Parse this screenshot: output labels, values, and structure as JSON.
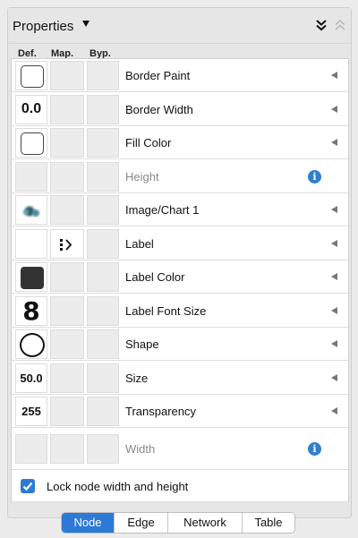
{
  "panel": {
    "title": "Properties",
    "header_icons": [
      "chevron-down-double-icon",
      "chevron-up-double-icon"
    ]
  },
  "columns": {
    "def": "Def.",
    "map": "Map.",
    "byp": "Byp."
  },
  "rows": [
    {
      "label": "Border Paint",
      "default": "",
      "default_icon": "outline-square-swatch",
      "enabled": true,
      "trailing": "arrow"
    },
    {
      "label": "Border Width",
      "default": "0.0",
      "enabled": true,
      "trailing": "arrow"
    },
    {
      "label": "Fill Color",
      "default": "",
      "default_icon": "outline-square-swatch",
      "enabled": true,
      "trailing": "arrow"
    },
    {
      "label": "Height",
      "default": "",
      "enabled": false,
      "trailing": "info"
    },
    {
      "label": "Image/Chart 1",
      "default": "",
      "default_icon": "blurred-dots-image",
      "enabled": true,
      "trailing": "arrow"
    },
    {
      "label": "Label",
      "default": "",
      "mapping_icon": "passthrough-mapping-icon",
      "enabled": true,
      "trailing": "arrow"
    },
    {
      "label": "Label Color",
      "default": "",
      "default_icon": "dark-square-swatch",
      "default_color": "#333333",
      "enabled": true,
      "trailing": "arrow"
    },
    {
      "label": "Label Font Size",
      "default": "8",
      "enabled": true,
      "trailing": "arrow"
    },
    {
      "label": "Shape",
      "default": "",
      "default_icon": "ellipse-shape",
      "enabled": true,
      "trailing": "arrow"
    },
    {
      "label": "Size",
      "default": "50.0",
      "enabled": true,
      "trailing": "arrow"
    },
    {
      "label": "Transparency",
      "default": "255",
      "enabled": true,
      "trailing": "arrow"
    },
    {
      "label": "Width",
      "default": "",
      "enabled": false,
      "trailing": "info"
    }
  ],
  "lock": {
    "label": "Lock node width and height",
    "checked": true
  },
  "tabs": [
    {
      "label": "Node",
      "active": true
    },
    {
      "label": "Edge",
      "active": false
    },
    {
      "label": "Network",
      "active": false
    },
    {
      "label": "Table",
      "active": false
    }
  ],
  "colors": {
    "accent": "#2c7ad6",
    "info": "#2f7fd0",
    "panel_bg": "#e6e6e6"
  }
}
